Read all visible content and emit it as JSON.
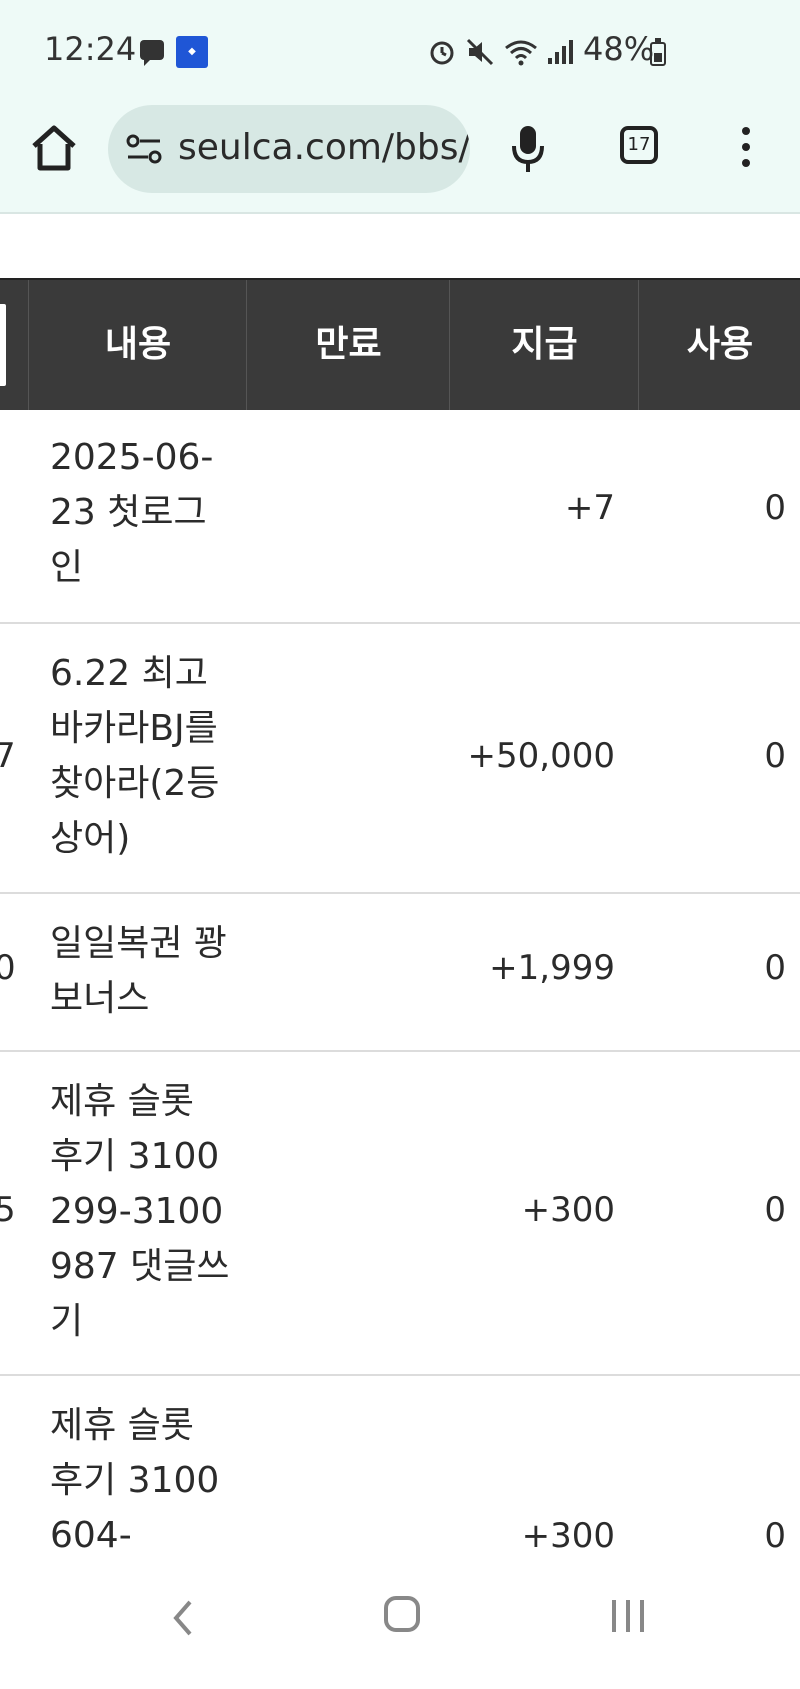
{
  "status_bar": {
    "time": "12:24",
    "battery_percent": "48%",
    "icons": [
      "chat-icon",
      "app-badge-icon",
      "alarm-icon",
      "mute-icon",
      "wifi-icon",
      "signal-icon",
      "battery-icon"
    ]
  },
  "browser": {
    "url": "seulca.com/bbs/",
    "tab_count": "17"
  },
  "table": {
    "headers": {
      "content": "내용",
      "expire": "만료",
      "pay": "지급",
      "use": "사용"
    },
    "rows": [
      {
        "edge": "",
        "content": "2025-06-23 첫로그인",
        "pay": "+7",
        "use": "0"
      },
      {
        "edge": "7",
        "content": "6.22 최고바카라BJ를 찾아라(2등 상어)",
        "pay": "+50,000",
        "use": "0"
      },
      {
        "edge": "0",
        "content": "일일복권 꽝 보너스",
        "pay": "+1,999",
        "use": "0"
      },
      {
        "edge": "5",
        "content": "제휴 슬롯 후기 3100299-3100987 댓글쓰기",
        "pay": "+300",
        "use": "0"
      },
      {
        "edge": "",
        "content": "제휴 슬롯 후기 3100604-",
        "pay": "+300",
        "use": "0"
      }
    ]
  }
}
